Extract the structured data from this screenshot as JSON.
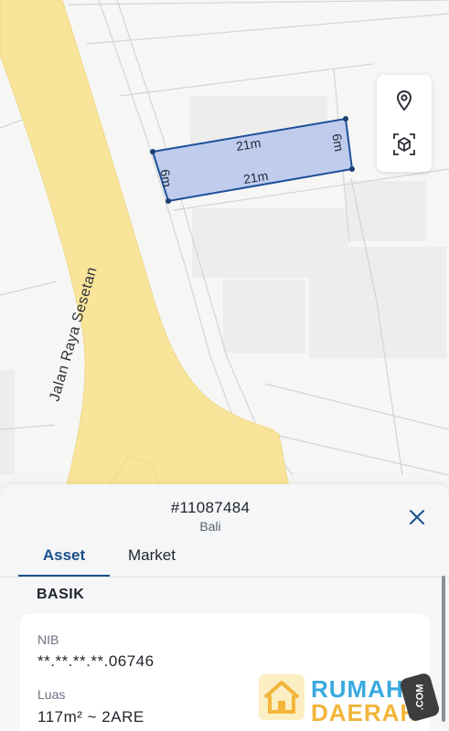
{
  "map": {
    "road_name": "Jalan Raya Sesetan",
    "parcel_dimensions": {
      "top": "21m",
      "bottom": "21m",
      "left": "6m",
      "right": "6m"
    },
    "controls": [
      {
        "icon": "location-pin-icon"
      },
      {
        "icon": "3d-cube-icon"
      }
    ]
  },
  "sheet": {
    "parcel_id": "#11087484",
    "region": "Bali",
    "tabs": [
      {
        "label": "Asset",
        "active": true
      },
      {
        "label": "Market",
        "active": false
      }
    ],
    "section_title": "BASIK",
    "fields": [
      {
        "label": "NIB",
        "value": "**.**.**.**.06746"
      },
      {
        "label": "Luas",
        "value": "117m² ~ 2ARE"
      }
    ]
  },
  "watermark": {
    "line1": "RUMAH",
    "line2": "DAERAH",
    "suffix": ".COM"
  },
  "colors": {
    "accent": "#1a4f8b",
    "road": "#f9e59a",
    "parcel_fill": "#b9c8ec",
    "parcel_stroke": "#1d4f9a"
  }
}
